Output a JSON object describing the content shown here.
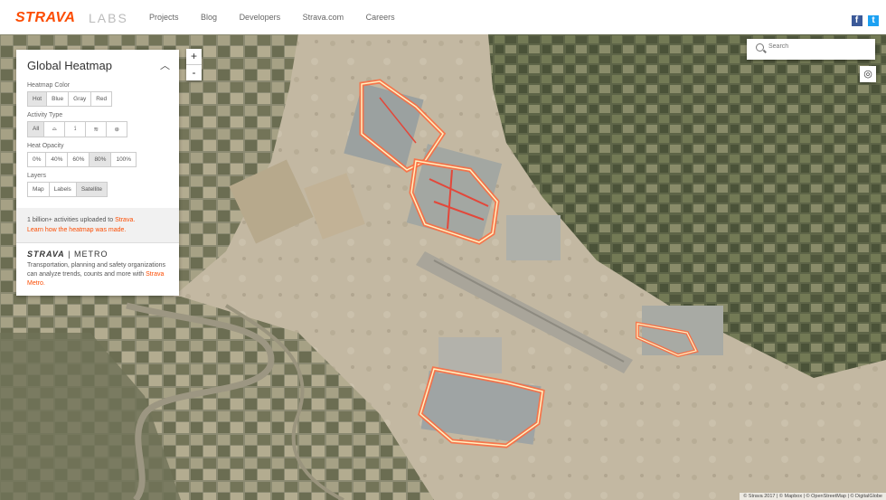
{
  "header": {
    "logo": "STRAVA",
    "logo_sub": "LABS",
    "nav": [
      "Projects",
      "Blog",
      "Developers",
      "Strava.com",
      "Careers"
    ],
    "social": {
      "facebook": "f",
      "twitter": "t"
    }
  },
  "panel": {
    "title": "Global Heatmap",
    "heatmap_color": {
      "label": "Heatmap Color",
      "options": [
        "Hot",
        "Blue",
        "Gray",
        "Red"
      ],
      "selected": "Hot"
    },
    "activity_type": {
      "label": "Activity Type",
      "options": [
        "All"
      ],
      "icons": [
        "bike-icon",
        "run-icon",
        "water-icon",
        "winter-icon"
      ],
      "selected": "All"
    },
    "heat_opacity": {
      "label": "Heat Opacity",
      "options": [
        "0%",
        "40%",
        "60%",
        "80%",
        "100%"
      ],
      "selected": "80%"
    },
    "layers": {
      "label": "Layers",
      "options": [
        "Map",
        "Labels",
        "Satellite"
      ],
      "selected": "Satellite"
    },
    "info": {
      "text": "1 billion+ activities uploaded to",
      "link": "Strava.",
      "link2": "Learn how the heatmap was made."
    },
    "metro": {
      "logo_a": "STRAVA",
      "logo_b": "METRO",
      "text": "Transportation, planning and safety organizations can analyze trends, counts and more with",
      "link": "Strava Metro."
    }
  },
  "map": {
    "zoom_in": "+",
    "zoom_out": "-",
    "search_placeholder": "Search",
    "attribution": "© Strava 2017 | © Mapbox | © OpenStreetMap | © DigitalGlobe",
    "heat_color": "#ff6a3d",
    "heat_core": "#fff2c2"
  }
}
